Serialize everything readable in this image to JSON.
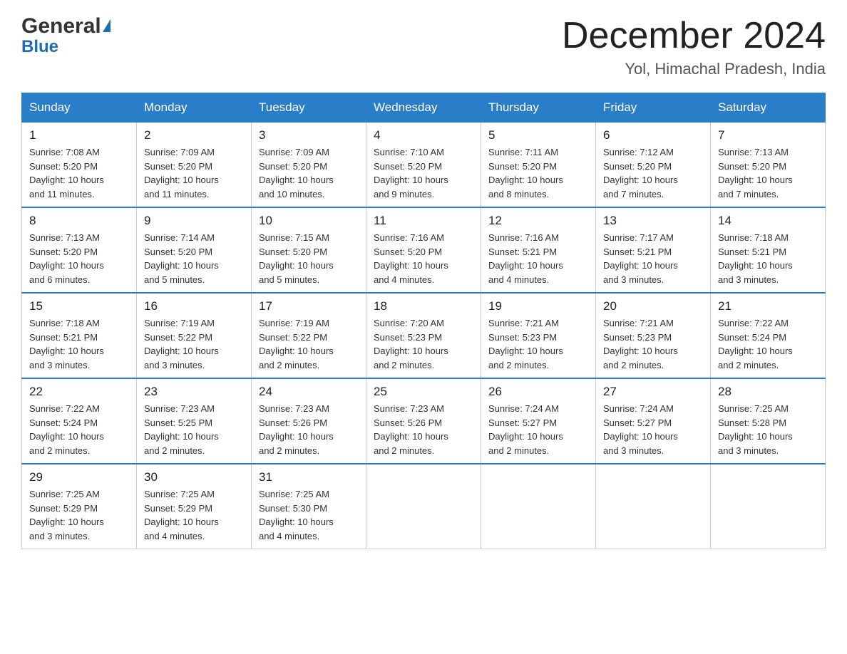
{
  "header": {
    "logo_general": "General",
    "logo_blue": "Blue",
    "month_title": "December 2024",
    "location": "Yol, Himachal Pradesh, India"
  },
  "weekdays": [
    "Sunday",
    "Monday",
    "Tuesday",
    "Wednesday",
    "Thursday",
    "Friday",
    "Saturday"
  ],
  "weeks": [
    [
      {
        "day": "1",
        "sunrise": "7:08 AM",
        "sunset": "5:20 PM",
        "daylight": "10 hours and 11 minutes."
      },
      {
        "day": "2",
        "sunrise": "7:09 AM",
        "sunset": "5:20 PM",
        "daylight": "10 hours and 11 minutes."
      },
      {
        "day": "3",
        "sunrise": "7:09 AM",
        "sunset": "5:20 PM",
        "daylight": "10 hours and 10 minutes."
      },
      {
        "day": "4",
        "sunrise": "7:10 AM",
        "sunset": "5:20 PM",
        "daylight": "10 hours and 9 minutes."
      },
      {
        "day": "5",
        "sunrise": "7:11 AM",
        "sunset": "5:20 PM",
        "daylight": "10 hours and 8 minutes."
      },
      {
        "day": "6",
        "sunrise": "7:12 AM",
        "sunset": "5:20 PM",
        "daylight": "10 hours and 7 minutes."
      },
      {
        "day": "7",
        "sunrise": "7:13 AM",
        "sunset": "5:20 PM",
        "daylight": "10 hours and 7 minutes."
      }
    ],
    [
      {
        "day": "8",
        "sunrise": "7:13 AM",
        "sunset": "5:20 PM",
        "daylight": "10 hours and 6 minutes."
      },
      {
        "day": "9",
        "sunrise": "7:14 AM",
        "sunset": "5:20 PM",
        "daylight": "10 hours and 5 minutes."
      },
      {
        "day": "10",
        "sunrise": "7:15 AM",
        "sunset": "5:20 PM",
        "daylight": "10 hours and 5 minutes."
      },
      {
        "day": "11",
        "sunrise": "7:16 AM",
        "sunset": "5:20 PM",
        "daylight": "10 hours and 4 minutes."
      },
      {
        "day": "12",
        "sunrise": "7:16 AM",
        "sunset": "5:21 PM",
        "daylight": "10 hours and 4 minutes."
      },
      {
        "day": "13",
        "sunrise": "7:17 AM",
        "sunset": "5:21 PM",
        "daylight": "10 hours and 3 minutes."
      },
      {
        "day": "14",
        "sunrise": "7:18 AM",
        "sunset": "5:21 PM",
        "daylight": "10 hours and 3 minutes."
      }
    ],
    [
      {
        "day": "15",
        "sunrise": "7:18 AM",
        "sunset": "5:21 PM",
        "daylight": "10 hours and 3 minutes."
      },
      {
        "day": "16",
        "sunrise": "7:19 AM",
        "sunset": "5:22 PM",
        "daylight": "10 hours and 3 minutes."
      },
      {
        "day": "17",
        "sunrise": "7:19 AM",
        "sunset": "5:22 PM",
        "daylight": "10 hours and 2 minutes."
      },
      {
        "day": "18",
        "sunrise": "7:20 AM",
        "sunset": "5:23 PM",
        "daylight": "10 hours and 2 minutes."
      },
      {
        "day": "19",
        "sunrise": "7:21 AM",
        "sunset": "5:23 PM",
        "daylight": "10 hours and 2 minutes."
      },
      {
        "day": "20",
        "sunrise": "7:21 AM",
        "sunset": "5:23 PM",
        "daylight": "10 hours and 2 minutes."
      },
      {
        "day": "21",
        "sunrise": "7:22 AM",
        "sunset": "5:24 PM",
        "daylight": "10 hours and 2 minutes."
      }
    ],
    [
      {
        "day": "22",
        "sunrise": "7:22 AM",
        "sunset": "5:24 PM",
        "daylight": "10 hours and 2 minutes."
      },
      {
        "day": "23",
        "sunrise": "7:23 AM",
        "sunset": "5:25 PM",
        "daylight": "10 hours and 2 minutes."
      },
      {
        "day": "24",
        "sunrise": "7:23 AM",
        "sunset": "5:26 PM",
        "daylight": "10 hours and 2 minutes."
      },
      {
        "day": "25",
        "sunrise": "7:23 AM",
        "sunset": "5:26 PM",
        "daylight": "10 hours and 2 minutes."
      },
      {
        "day": "26",
        "sunrise": "7:24 AM",
        "sunset": "5:27 PM",
        "daylight": "10 hours and 2 minutes."
      },
      {
        "day": "27",
        "sunrise": "7:24 AM",
        "sunset": "5:27 PM",
        "daylight": "10 hours and 3 minutes."
      },
      {
        "day": "28",
        "sunrise": "7:25 AM",
        "sunset": "5:28 PM",
        "daylight": "10 hours and 3 minutes."
      }
    ],
    [
      {
        "day": "29",
        "sunrise": "7:25 AM",
        "sunset": "5:29 PM",
        "daylight": "10 hours and 3 minutes."
      },
      {
        "day": "30",
        "sunrise": "7:25 AM",
        "sunset": "5:29 PM",
        "daylight": "10 hours and 4 minutes."
      },
      {
        "day": "31",
        "sunrise": "7:25 AM",
        "sunset": "5:30 PM",
        "daylight": "10 hours and 4 minutes."
      },
      null,
      null,
      null,
      null
    ]
  ]
}
